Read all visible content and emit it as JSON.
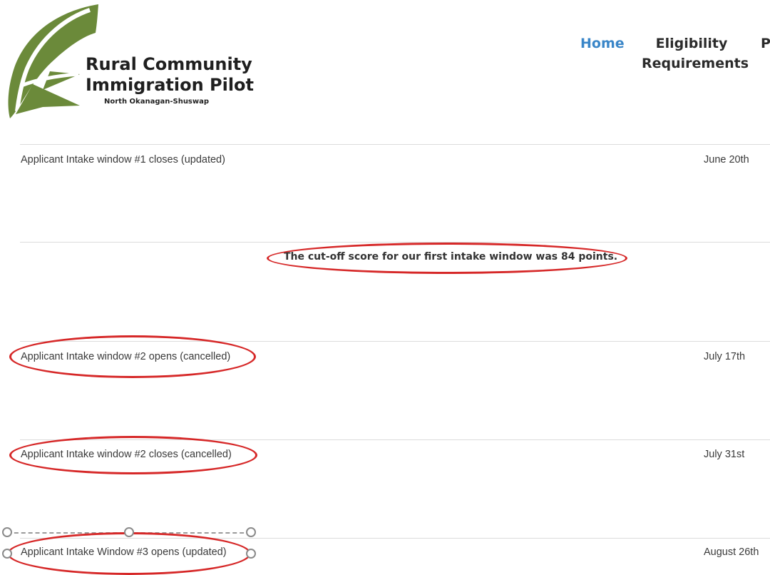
{
  "brand": {
    "line1": "Rural Community",
    "line2": "Immigration Pilot",
    "subtitle": "North Okanagan-Shuswap",
    "leaf_color": "#6b8a3a"
  },
  "nav": {
    "items": [
      {
        "label": "Home",
        "active": true
      },
      {
        "label": "Eligibility",
        "label2": "Requirements"
      },
      {
        "label": "P"
      }
    ],
    "active_color": "#3a86c8"
  },
  "schedule": {
    "rows": [
      {
        "label": "Applicant Intake window #1 closes (updated)",
        "date": "June 20th"
      },
      {
        "label": "Applicant Intake window #2 opens (cancelled)",
        "date": "July 17th"
      },
      {
        "label": "Applicant Intake window #2 closes (cancelled)",
        "date": "July 31st"
      },
      {
        "label": "Applicant Intake Window #3 opens (updated)",
        "date": "August 26th"
      }
    ],
    "notice": "The cut-off score for our first intake window was 84 points."
  },
  "annotation_color": "#d62828"
}
